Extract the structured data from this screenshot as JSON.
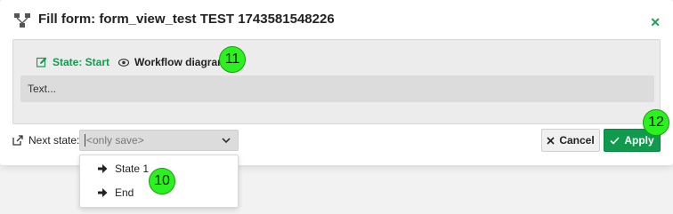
{
  "header": {
    "title": "Fill form: form_view_test TEST 1743581548226",
    "close_icon": "close-icon"
  },
  "tabs": [
    {
      "label": "State: Start",
      "icon": "edit-icon"
    },
    {
      "label": "Workflow diagram",
      "icon": "eye-icon"
    }
  ],
  "form": {
    "text_value": "Text..."
  },
  "footer": {
    "next_state_label": "Next state:",
    "next_state_icon": "external-link-icon",
    "select_value": "<only save>",
    "options": [
      {
        "label": "State 1",
        "icon": "arrow-right-icon"
      },
      {
        "label": "End",
        "icon": "arrow-right-icon"
      }
    ],
    "cancel_label": "Cancel",
    "apply_label": "Apply"
  },
  "annotations": [
    "11",
    "12",
    "10"
  ],
  "colors": {
    "accent": "#139a4b",
    "apply_bg": "#0f9a4e",
    "badge": "#2bf21e"
  }
}
